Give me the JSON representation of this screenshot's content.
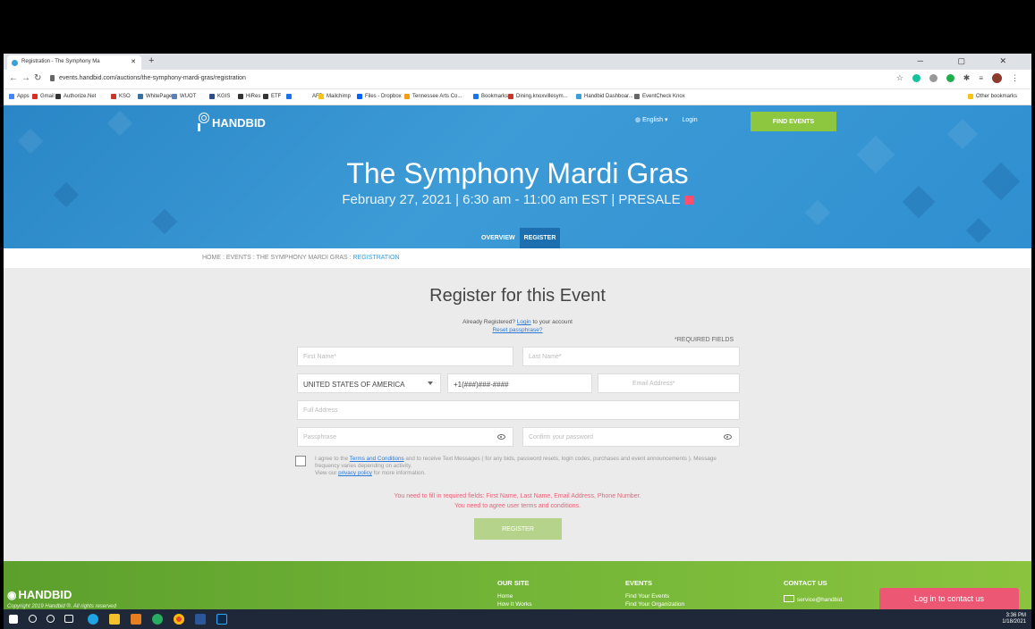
{
  "browser": {
    "tab_title": "Registration - The Symphony Ma",
    "new_tab": "+",
    "tab_close": "✕",
    "window_controls": "─ ▢ ✕",
    "url": "events.handbid.com/auctions/the-symphony-mardi-gras/registration",
    "bookmarks": [
      {
        "label": "Apps",
        "color": "#4285f4"
      },
      {
        "label": "Gmail",
        "color": "#d93025"
      },
      {
        "label": "Authorize.Net",
        "color": "#333333"
      },
      {
        "label": "KSO",
        "color": "#c0392b"
      },
      {
        "label": "WhitePages",
        "color": "#3c6e9f"
      },
      {
        "label": "WUOT",
        "color": "#5b7fb8"
      },
      {
        "label": "KGIS",
        "color": "#2c4f8a"
      },
      {
        "label": "HiRes",
        "color": "#333333"
      },
      {
        "label": "ETF",
        "color": "#333333"
      },
      {
        "label": "",
        "color": "#1a73e8"
      },
      {
        "label": "AFP",
        "color": "#ffffff"
      },
      {
        "label": "Mailchimp",
        "color": "#f4c518"
      },
      {
        "label": "Files - Dropbox",
        "color": "#0061ff"
      },
      {
        "label": "Tennessee Arts Co...",
        "color": "#f39c12"
      },
      {
        "label": "Bookmarks",
        "color": "#1a73e8"
      },
      {
        "label": "Dining.knoxvillesym...",
        "color": "#c0392b"
      },
      {
        "label": "Handbid Dashboar...",
        "color": "#3aa0d8"
      },
      {
        "label": "EventCheck Knox",
        "color": "#666666"
      }
    ],
    "other_bookmarks": "Other bookmarks"
  },
  "header": {
    "logo_text": "HANDBID",
    "language": "English",
    "login": "Login",
    "find_events": "FIND EVENTS"
  },
  "event": {
    "title": "The Symphony Mardi Gras",
    "subtitle": "February 27, 2021 | 6:30 am - 11:00 am EST | PRESALE"
  },
  "subnav": {
    "overview": "OVERVIEW",
    "register": "REGISTER"
  },
  "breadcrumb": {
    "path": "HOME : EVENTS : THE SYMPHONY MARDI GRAS : ",
    "current": "REGISTRATION"
  },
  "form": {
    "title": "Register for this Event",
    "already_prefix": "Already Registered? ",
    "already_link": "Login",
    "already_suffix": " to your account",
    "reset_link": "Reset passphrase?",
    "required_note": "*REQUIRED FIELDS",
    "first_name_placeholder": "First Name*",
    "last_name_placeholder": "Last Name*",
    "country_value": "UNITED STATES OF AMERICA",
    "phone_value": "+1(###)###-####",
    "email_placeholder": "Email Address*",
    "address_placeholder": "Full Address",
    "passphrase_placeholder": "Passphrase",
    "confirm_placeholder": "Confirm your password",
    "terms_prefix": "I agree to the ",
    "terms_link": "Terms and Conditions",
    "terms_middle": " and to receive Text Messages ( for any bids, password resets, login codes, purchases and event announcements ). Message frequency varies depending on activity.",
    "view_prefix": "View our ",
    "privacy_link": "privacy policy",
    "view_suffix": " for more information.",
    "error_1": "You need to fill in required fields: First Name, Last Name, Email Address, Phone Number.",
    "error_2": "You need to agree user terms and conditions.",
    "register_button": "REGISTER"
  },
  "footer": {
    "logo_text": "HANDBID",
    "copyright": "Copyright 2019 Handbid ®. All rights reserved",
    "our_site_head": "OUR SITE",
    "our_site_links": [
      "Home",
      "How It Works"
    ],
    "events_head": "EVENTS",
    "events_links": [
      "Find Your Events",
      "Find Your Organization"
    ],
    "contact_head": "CONTACT US",
    "contact_email": "service@handbid.",
    "contact_button": "Log in to contact us"
  },
  "taskbar": {
    "time": "3:36 PM",
    "date": "1/18/2021"
  },
  "colors": {
    "brand_blue": "#3a9ad9",
    "find_green": "#8dc63f",
    "error_pink": "#e8627a",
    "contact_pink": "#ec5874"
  }
}
